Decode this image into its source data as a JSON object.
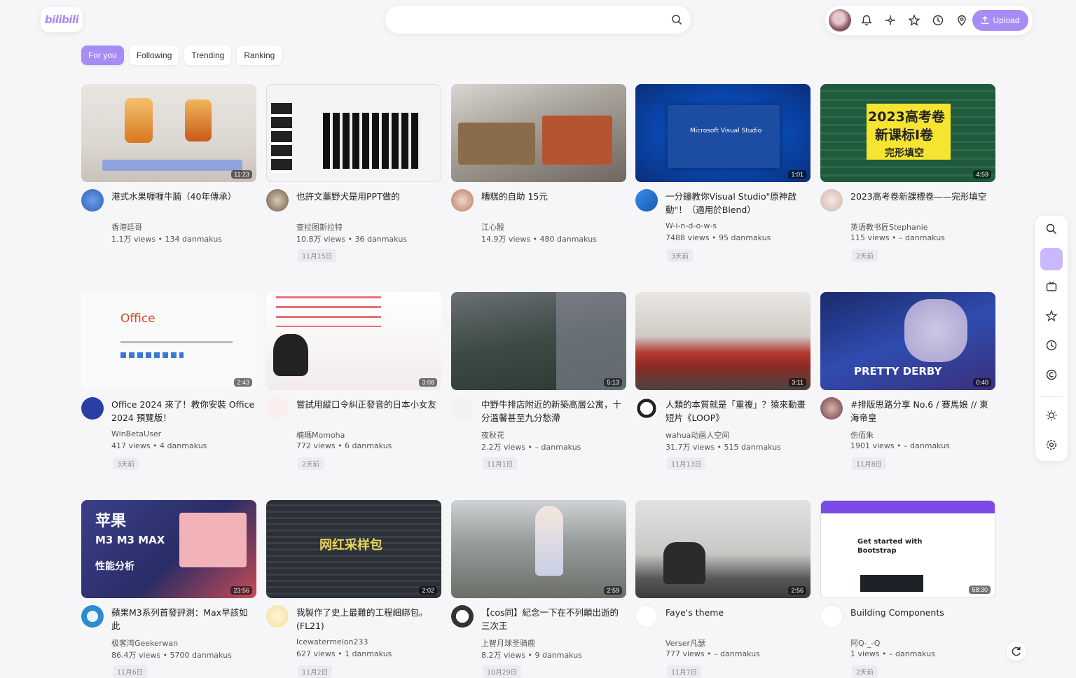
{
  "header": {
    "logo_text": "bilibili",
    "search_placeholder": "",
    "upload_label": "Upload"
  },
  "tabs": [
    "For you",
    "Following",
    "Trending",
    "Ranking"
  ],
  "videos": [
    {
      "title": "港式水果喱喱牛腩（40年傳承）",
      "author": "香港廷哥",
      "stats": "1.1万 views • 134 danmakus",
      "date": "",
      "duration": "11:23"
    },
    {
      "title": "也許文藁野犬是用PPT做的",
      "author": "查拉图斯拉特",
      "stats": "10.8万 views • 36 danmakus",
      "date": "11月15日",
      "duration": ""
    },
    {
      "title": "糟糕的自助 15元",
      "author": "江心骰",
      "stats": "14.9万 views • 480 danmakus",
      "date": "",
      "duration": ""
    },
    {
      "title": "一分鐘教你Visual Studio\"原神啟動\"！（適用於Blend）",
      "author": "W-i-n-d-o-w-s",
      "stats": "7488 views • 95 danmakus",
      "date": "3天前",
      "duration": "1:01"
    },
    {
      "title": "2023高考卷新課標卷——完形填空",
      "author": "英语教书匠Stephanie",
      "stats": "115 views • – danmakus",
      "date": "2天前",
      "duration": "4:59"
    },
    {
      "title": "Office 2024 來了！教你安裝 Office 2024 預覽版！",
      "author": "WinBetaUser",
      "stats": "417 views • 4 danmakus",
      "date": "3天前",
      "duration": "2:43"
    },
    {
      "title": "嘗試用縱口令糾正發音的日本小女友",
      "author": "楠瑪Momoha",
      "stats": "772 views • 6 danmakus",
      "date": "2天前",
      "duration": "3:08"
    },
    {
      "title": "中野牛排店附近的新築高層公寓，十分溫馨甚至九分愁滯",
      "author": "夜秋花",
      "stats": "2.2万 views • – danmakus",
      "date": "11月1日",
      "duration": "5:13"
    },
    {
      "title": "人類的本質就是「重複」？猿來動畫短片《LOOP》",
      "author": "wahua动画人空间",
      "stats": "31.7万 views • 515 danmakus",
      "date": "11月13日",
      "duration": "3:11"
    },
    {
      "title": "#排版思路分享 No.6 / 賽馬娘 // 東海帝皇",
      "author": "伤佰朱",
      "stats": "1901 views • – danmakus",
      "date": "11月8日",
      "duration": "0:40"
    },
    {
      "title": "蘋果M3系列首發評測：Max早該如此",
      "author": "极客湾Geekerwan",
      "stats": "86.4万 views • 5700 danmakus",
      "date": "11月6日",
      "duration": "23:56"
    },
    {
      "title": "我製作了史上最難的工程細綁包。(FL21)",
      "author": "Icewatermelon233",
      "stats": "627 views • 1 danmakus",
      "date": "11月2日",
      "duration": "2:02"
    },
    {
      "title": "【cos同】紀念一下在不列顛出逝的三次王",
      "author": "上智月球圣骑鹿",
      "stats": "8.2万 views • 9 danmakus",
      "date": "10月29日",
      "duration": "2:59"
    },
    {
      "title": "Faye's theme",
      "author": "Verser凡瑟",
      "stats": "777 views • – danmakus",
      "date": "11月7日",
      "duration": "2:56"
    },
    {
      "title": "Building Components",
      "author": "阿Q-_-Q",
      "stats": "1 views • – danmakus",
      "date": "2天前",
      "duration": "58:30"
    }
  ],
  "thumb_text": {
    "office": "Office",
    "vs": "Microsoft Visual Studio",
    "exam1": "2023高考卷",
    "exam2": "新课标I卷",
    "exam3": "完形填空",
    "derby": "PRETTY DERBY",
    "apple1": "苹果",
    "apple2": "M3 M3 MAX",
    "apple3": "性能分析",
    "pack": "网红采样包",
    "bootstrap": "Get started with Bootstrap"
  },
  "colors": {
    "accent": "#a78cf5",
    "background": "#f6f6f8"
  },
  "icons": {
    "search": "search-icon",
    "bell": "bell-icon",
    "star": "star-icon",
    "history": "clock-icon",
    "location": "pin-icon",
    "upload": "upload-icon"
  }
}
